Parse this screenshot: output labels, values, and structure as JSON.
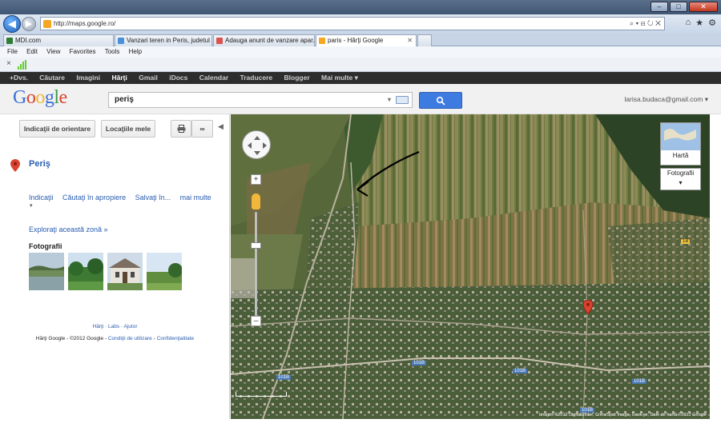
{
  "browser": {
    "url": "http://maps.google.ro/",
    "tabs": [
      {
        "label": "MDI.com",
        "color": "#2e7d32"
      },
      {
        "label": "Vanzari teren in Peris, judetul I...",
        "color": "#4a90d9"
      },
      {
        "label": "Adauga anunt de vanzare apar...",
        "color": "#d9534f"
      },
      {
        "label": "paris - Hărţi Google",
        "color": "#f5a623"
      }
    ],
    "menu": [
      "File",
      "Edit",
      "View",
      "Favorites",
      "Tools",
      "Help"
    ]
  },
  "gbar": {
    "items": [
      "+Dvs.",
      "Căutare",
      "Imagini",
      "Hărţi",
      "Gmail",
      "iDocs",
      "Calendar",
      "Traducere",
      "Blogger",
      "Mai multe ▾"
    ],
    "active_index": 3
  },
  "header": {
    "logo": "Google",
    "search_value": "periş",
    "account": "larisa.budaca@gmail.com ▾"
  },
  "panel": {
    "directions_button": "Indicaţii de orientare",
    "my_places_button": "Locaţiile mele",
    "place_name": "Periş",
    "links": [
      "Indicaţii",
      "Căutaţi în apropiere",
      "Salvaţi în...",
      "mai multe"
    ],
    "explore_link": "Exploraţi această zonă »",
    "photos_heading": "Fotografii",
    "footer_links": "Hărţi · Labs · Ajutor",
    "footer_copyright": "Hărţi Google - ©2012 Google - ",
    "footer_terms": "Condiţii de utilizare",
    "footer_privacy": "Confidenţialitate"
  },
  "map": {
    "map_type_button": "Hartă",
    "photos_button": "Fotografii",
    "road_labels": [
      "101B",
      "101B",
      "101B",
      "101B",
      "101B"
    ],
    "route_label": "1B",
    "copyright": "Imagini ©2012 DigitalGlobe, Cnes/Spot Image, GeoEye, Date de hartă ©2012 Google"
  },
  "colors": {
    "accent": "#3d7be0",
    "link": "#2a5db0",
    "gbar": "#2d2d2d",
    "marker": "#d9432f"
  }
}
